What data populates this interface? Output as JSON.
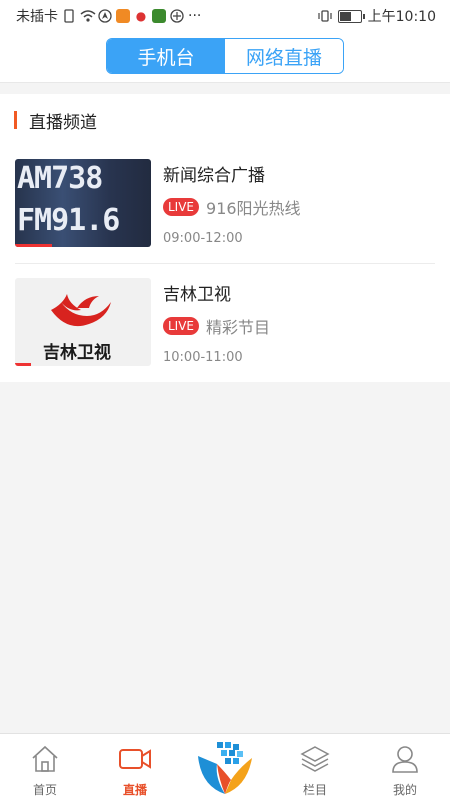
{
  "status_bar": {
    "carrier": "未插卡",
    "time": "上午10:10",
    "more": "···",
    "battery_level": 0.5
  },
  "header": {
    "tabs": [
      {
        "label": "手机台",
        "active": true
      },
      {
        "label": "网络直播",
        "active": false
      }
    ],
    "accent_color": "#3ba3f6"
  },
  "section": {
    "title": "直播频道",
    "accent_color": "#f15a24"
  },
  "channels": [
    {
      "name": "新闻综合广播",
      "live_badge": "LIVE",
      "program": "916阳光热线",
      "time": "09:00-12:00",
      "thumb_line1": "AM738",
      "thumb_line2": "FM91.6",
      "progress": 0.27
    },
    {
      "name": "吉林卫视",
      "live_badge": "LIVE",
      "program": "精彩节目",
      "time": "10:00-11:00",
      "thumb_logo_text": "吉林卫视",
      "progress": 0.12
    }
  ],
  "tabbar": {
    "items": [
      {
        "label": "首页",
        "icon": "home-icon",
        "active": false
      },
      {
        "label": "直播",
        "icon": "video-camera-icon",
        "active": true
      },
      {
        "label": "",
        "icon": "app-logo-icon",
        "active": false
      },
      {
        "label": "栏目",
        "icon": "layers-icon",
        "active": false
      },
      {
        "label": "我的",
        "icon": "user-icon",
        "active": false
      }
    ],
    "active_color": "#e8502a"
  }
}
